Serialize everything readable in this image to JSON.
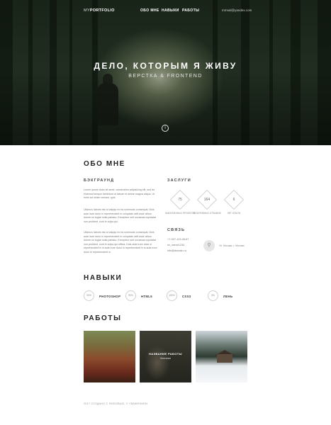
{
  "header": {
    "logo_prefix": "MY",
    "logo_bold": "PORTFOLIO",
    "nav": [
      "ОБО МНЕ",
      "НАВЫКИ",
      "РАБОТЫ"
    ],
    "email": "mrmail@yandex.com"
  },
  "hero": {
    "title": "ДЕЛО, КОТОРЫМ Я ЖИВУ",
    "subtitle": "ВЕРСТКА & FRONTEND",
    "scroll_icon": "info-icon"
  },
  "about": {
    "title": "ОБО МНЕ",
    "background_title": "БЭКГРАУНД",
    "paragraphs": [
      "Lorem ipsum dolor sit amet, consectetur adipisicing elit, sed do eiusmod tempor incididunt ut labore et dolore magna aliqua. Ut enim ad minim veniam, quis.",
      "Ullamco laboris nisi ut aliquip ex ea commodo consequat. Duis aute irure dolor in reprehenderit in voluptate velit esse cillum dolore eu fugiat nulla pariatur. Excepteur sint occaecat cupidatat non proident, sunt in culpa qui.",
      "Ullamco laboris nisi ut aliquip ex ea commodo consequat. Duis aute irure dolor in reprehenderit in voluptate velit esse cillum dolore eu fugiat nulla pariatur. Excepteur sint occaecat cupidatat non proident, sunt in culpa qui officia. Duis aute irure dolor in reprehenderit in is aute irure dolor in reprehenderit in is aute irure dolor in reprehenderit in."
    ],
    "merits_title": "ЗАСЛУГИ",
    "stats": [
      {
        "value": "75",
        "label": "ЗАКОНЧЕННЫХ ПРОЕКТОВ"
      },
      {
        "value": "164",
        "label": "ПОЗИТИВНЫХ ОТЗЫВОВ"
      },
      {
        "value": "6",
        "label": "ЛЕТ ОПЫТА"
      }
    ],
    "contacts_title": "СВЯЗЬ",
    "contacts": [
      "+7-927-123-45-67",
      "ex_name1234",
      "info@domain.ru"
    ],
    "address": "Ул. Москва, г. Москва"
  },
  "skills": {
    "title": "НАВЫКИ",
    "items": [
      {
        "level": "90%",
        "name": "PHOTOSHOP"
      },
      {
        "level": "90%",
        "name": "HTML5"
      },
      {
        "level": "100%",
        "name": "CSS3"
      },
      {
        "level": "0%",
        "name": "ЛЕНЬ"
      }
    ]
  },
  "works": {
    "title": "РАБОТЫ",
    "featured_title": "НАЗВАНИЕ РАБОТЫ",
    "featured_sub": "Описание"
  },
  "footer": {
    "text": "2017 СОЗДАНО С ЛЮБОВЬЮ, С УВАЖЕНИЕМ"
  }
}
